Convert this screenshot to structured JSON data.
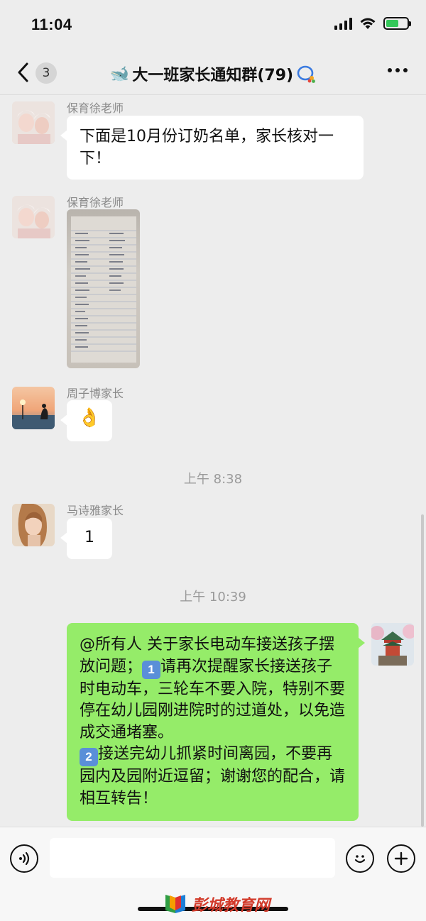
{
  "status": {
    "time": "11:04"
  },
  "nav": {
    "back_count": "3",
    "title_emoji": "🐋",
    "title": "大一班家长通知群(79)"
  },
  "messages": [
    {
      "sender": "保育徐老师",
      "text": "下面是10月份订奶名单，家长核对一下！"
    },
    {
      "sender": "保育徐老师",
      "type": "image"
    },
    {
      "sender": "周子博家长",
      "text": "👌"
    },
    {
      "time": "上午 8:38"
    },
    {
      "sender": "马诗雅家长",
      "text": "1"
    },
    {
      "time": "上午 10:39"
    },
    {
      "sender": "me",
      "line1": "@所有人  关于家长电动车接送孩子摆放问题；",
      "key1": "1",
      "line2": "请再次提醒家长接送孩子时电动车，三轮车不要入院，特别不要停在幼儿园刚进院时的过道处，以免造成交通堵塞。",
      "key2": "2",
      "line3": "接送完幼儿抓紧时间离园，不要再园内及园附近逗留；谢谢您的配合，请相互转告！"
    }
  ],
  "input": {
    "placeholder": ""
  },
  "watermark": {
    "text": "彭城教育网"
  },
  "colors": {
    "self_bubble": "#95ec69",
    "background": "#ededed",
    "watermark": "#d23a2a"
  }
}
